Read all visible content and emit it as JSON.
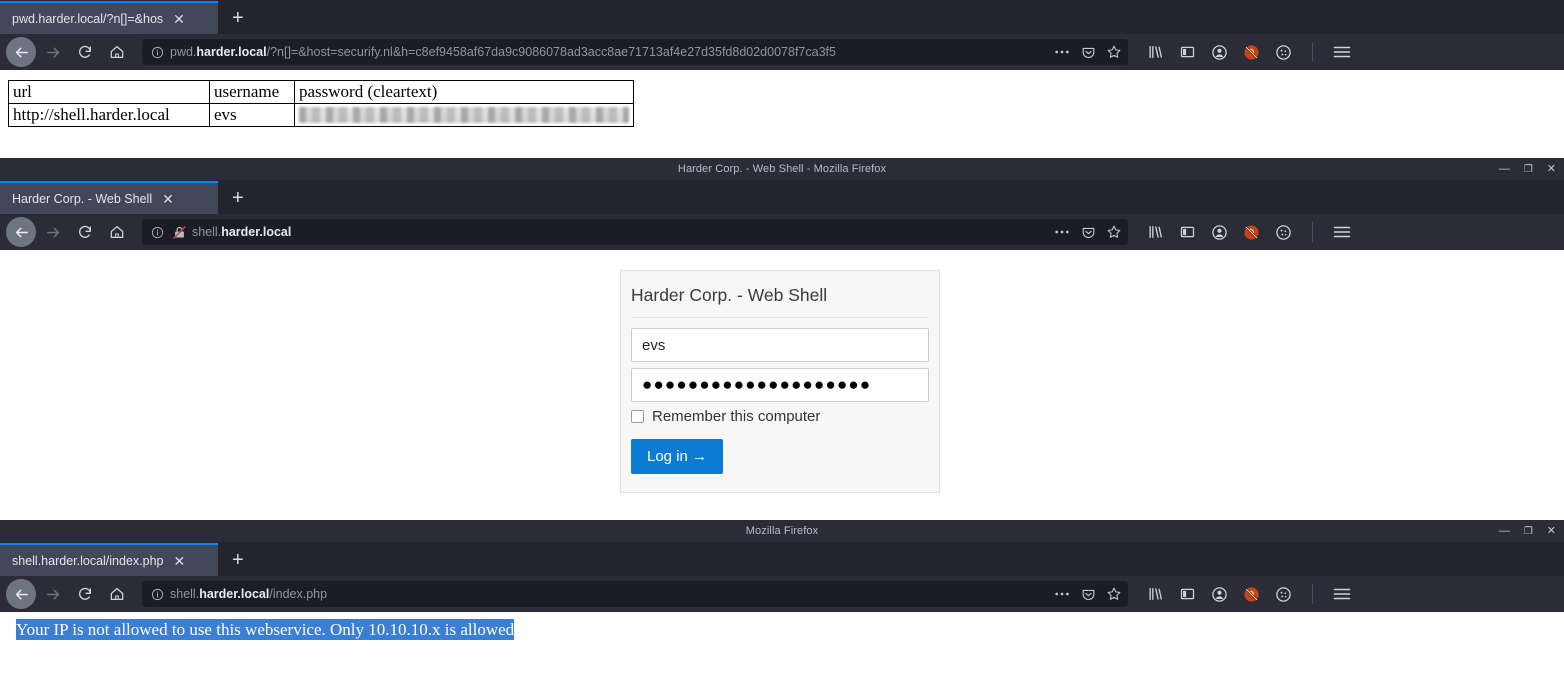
{
  "windows": [
    {
      "id": "pwd-window",
      "tab": {
        "label": "pwd.harder.local/?n[]=&hos",
        "close": "✕"
      },
      "newtab": "+",
      "url": {
        "prefix": "pwd.",
        "bold": "harder.local",
        "suffix": "/?n[]=&host=securify.nl&h=c8ef9458af67da9c9086078ad3acc8ae71713af4e27d35fd8d02d0078f7ca3f5",
        "info_icon": "info-icon"
      },
      "table": {
        "headers": [
          "url",
          "username",
          "password (cleartext)"
        ],
        "rows": [
          {
            "url": "http://shell.harder.local",
            "username": "evs",
            "password": ""
          }
        ]
      }
    },
    {
      "id": "webshell-window",
      "title": "Harder Corp. - Web Shell - Mozilla Firefox",
      "tab": {
        "label": "Harder Corp. - Web Shell",
        "close": "✕"
      },
      "newtab": "+",
      "url": {
        "prefix": "shell.",
        "bold": "harder.local",
        "suffix": "",
        "info_icon": "info-icon",
        "insecure_icon": "insecure-login-icon"
      },
      "login": {
        "heading": "Harder Corp. - Web Shell",
        "username_value": "evs",
        "username_placeholder": "",
        "password_value": "●●●●●●●●●●●●●●●●●●●●",
        "password_placeholder": "",
        "remember_label": "Remember this computer",
        "submit_label": "Log in →"
      }
    },
    {
      "id": "index-window",
      "title": "Mozilla Firefox",
      "tab": {
        "label": "shell.harder.local/index.php",
        "close": "✕"
      },
      "newtab": "+",
      "url": {
        "prefix": "shell.",
        "bold": "harder.local",
        "suffix": "/index.php",
        "info_icon": "info-icon"
      },
      "message": "Your IP is not allowed to use this webservice. Only 10.10.10.x is allowed"
    }
  ],
  "window_buttons": {
    "minimize": "—",
    "maximize": "❐",
    "close": "✕"
  },
  "toolbar_icons": [
    "library-icon",
    "sidebar-icon",
    "account-icon",
    "blocked-icon",
    "cookie-icon",
    "menu-icon"
  ],
  "url_actions": [
    "page-actions-icon",
    "pocket-icon",
    "bookmark-star-icon"
  ],
  "colors": {
    "tabstrip": "#23242c",
    "toolbar": "#2b2c38",
    "urlfield": "#1c1d24",
    "tab_active": "#42475a",
    "tab_accent": "#0a84ff",
    "login_button": "#0b7bd4",
    "selection": "#3b7fd4"
  }
}
